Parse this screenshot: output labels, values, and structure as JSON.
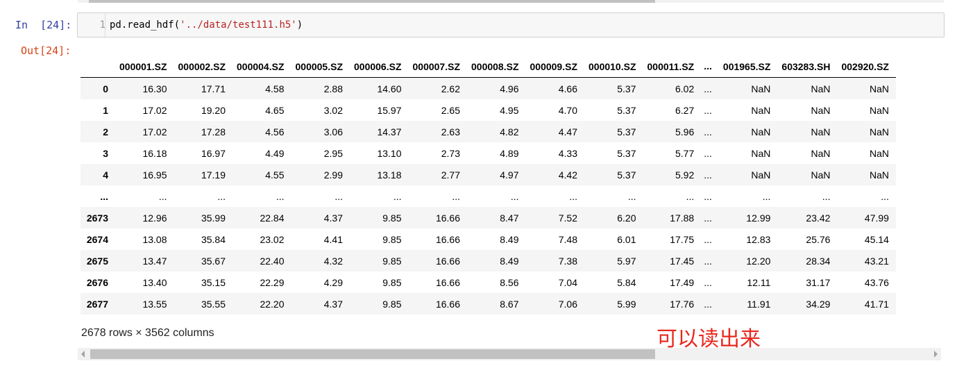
{
  "input_prompt": "In  [24]:",
  "output_prompt": "Out[24]:",
  "code_cell": {
    "line_number": "1",
    "code_prefix": "pd.read_hdf(",
    "code_string": "'../data/test111.h5'",
    "code_suffix": ")"
  },
  "dataframe": {
    "columns": [
      "000001.SZ",
      "000002.SZ",
      "000004.SZ",
      "000005.SZ",
      "000006.SZ",
      "000007.SZ",
      "000008.SZ",
      "000009.SZ",
      "000010.SZ",
      "000011.SZ",
      "...",
      "001965.SZ",
      "603283.SH",
      "002920.SZ"
    ],
    "rows": [
      {
        "index": "0",
        "values": [
          "16.30",
          "17.71",
          "4.58",
          "2.88",
          "14.60",
          "2.62",
          "4.96",
          "4.66",
          "5.37",
          "6.02",
          "...",
          "NaN",
          "NaN",
          "NaN"
        ]
      },
      {
        "index": "1",
        "values": [
          "17.02",
          "19.20",
          "4.65",
          "3.02",
          "15.97",
          "2.65",
          "4.95",
          "4.70",
          "5.37",
          "6.27",
          "...",
          "NaN",
          "NaN",
          "NaN"
        ]
      },
      {
        "index": "2",
        "values": [
          "17.02",
          "17.28",
          "4.56",
          "3.06",
          "14.37",
          "2.63",
          "4.82",
          "4.47",
          "5.37",
          "5.96",
          "...",
          "NaN",
          "NaN",
          "NaN"
        ]
      },
      {
        "index": "3",
        "values": [
          "16.18",
          "16.97",
          "4.49",
          "2.95",
          "13.10",
          "2.73",
          "4.89",
          "4.33",
          "5.37",
          "5.77",
          "...",
          "NaN",
          "NaN",
          "NaN"
        ]
      },
      {
        "index": "4",
        "values": [
          "16.95",
          "17.19",
          "4.55",
          "2.99",
          "13.18",
          "2.77",
          "4.97",
          "4.42",
          "5.37",
          "5.92",
          "...",
          "NaN",
          "NaN",
          "NaN"
        ]
      },
      {
        "index": "...",
        "values": [
          "...",
          "...",
          "...",
          "...",
          "...",
          "...",
          "...",
          "...",
          "...",
          "...",
          "...",
          "...",
          "...",
          "..."
        ]
      },
      {
        "index": "2673",
        "values": [
          "12.96",
          "35.99",
          "22.84",
          "4.37",
          "9.85",
          "16.66",
          "8.47",
          "7.52",
          "6.20",
          "17.88",
          "...",
          "12.99",
          "23.42",
          "47.99"
        ]
      },
      {
        "index": "2674",
        "values": [
          "13.08",
          "35.84",
          "23.02",
          "4.41",
          "9.85",
          "16.66",
          "8.49",
          "7.48",
          "6.01",
          "17.75",
          "...",
          "12.83",
          "25.76",
          "45.14"
        ]
      },
      {
        "index": "2675",
        "values": [
          "13.47",
          "35.67",
          "22.40",
          "4.32",
          "9.85",
          "16.66",
          "8.49",
          "7.38",
          "5.97",
          "17.45",
          "...",
          "12.20",
          "28.34",
          "43.21"
        ]
      },
      {
        "index": "2676",
        "values": [
          "13.40",
          "35.15",
          "22.29",
          "4.29",
          "9.85",
          "16.66",
          "8.56",
          "7.04",
          "5.84",
          "17.49",
          "...",
          "12.11",
          "31.17",
          "43.76"
        ]
      },
      {
        "index": "2677",
        "values": [
          "13.55",
          "35.55",
          "22.20",
          "4.37",
          "9.85",
          "16.66",
          "8.67",
          "7.06",
          "5.99",
          "17.76",
          "...",
          "11.91",
          "34.29",
          "41.71"
        ]
      }
    ]
  },
  "shape_info": "2678 rows × 3562 columns",
  "annotation": "可以读出来",
  "icons": {
    "scroll_left": "scroll-left-arrow-icon",
    "scroll_right": "scroll-right-arrow-icon"
  },
  "colors": {
    "input_prompt": "#303f9f",
    "output_prompt": "#d84315",
    "string_literal": "#ba2121",
    "annotation": "#e8281e"
  }
}
